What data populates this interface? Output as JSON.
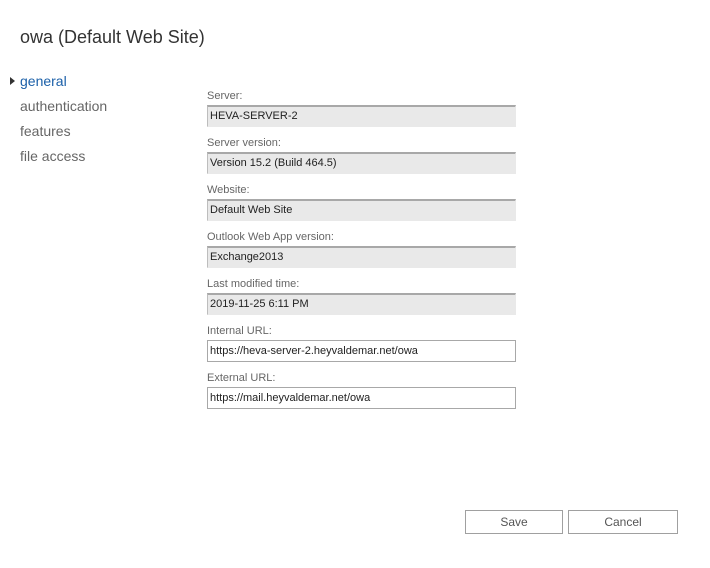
{
  "header": {
    "title": "owa (Default Web Site)"
  },
  "nav": {
    "items": [
      {
        "label": "general",
        "active": true
      },
      {
        "label": "authentication",
        "active": false
      },
      {
        "label": "features",
        "active": false
      },
      {
        "label": "file access",
        "active": false
      }
    ]
  },
  "form": {
    "server": {
      "label": "Server:",
      "value": "HEVA-SERVER-2"
    },
    "server_version": {
      "label": "Server version:",
      "value": "Version 15.2 (Build 464.5)"
    },
    "website": {
      "label": "Website:",
      "value": "Default Web Site"
    },
    "owa_version": {
      "label": "Outlook Web App version:",
      "value": "Exchange2013"
    },
    "last_modified": {
      "label": "Last modified time:",
      "value": "2019-11-25 6:11 PM"
    },
    "internal_url": {
      "label": "Internal URL:",
      "value": "https://heva-server-2.heyvaldemar.net/owa"
    },
    "external_url": {
      "label": "External URL:",
      "value": "https://mail.heyvaldemar.net/owa"
    }
  },
  "actions": {
    "save_label": "Save",
    "cancel_label": "Cancel"
  },
  "colors": {
    "accent": "#1a5fa8",
    "readonly_bg": "#e9e9e9",
    "border": "#a8a8a8"
  }
}
